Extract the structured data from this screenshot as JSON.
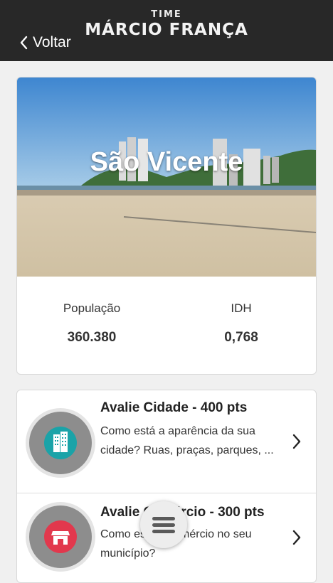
{
  "header": {
    "back_label": "Voltar",
    "brand_top": "TIME",
    "brand_main": "MÁRCIO FRANÇA",
    "background": "#282828"
  },
  "city": {
    "name": "São Vicente",
    "stats": [
      {
        "label": "População",
        "value": "360.380"
      },
      {
        "label": "IDH",
        "value": "0,768"
      }
    ]
  },
  "tasks": [
    {
      "title": "Avalie Cidade - 400 pts",
      "description": "Como está a aparência da sua cidade? Ruas, praças, parques, ...",
      "icon": "buildings-icon",
      "icon_color": "#1aa3a8"
    },
    {
      "title": "Avalie Comércio - 300 pts",
      "description": "Como está o comércio no seu município?",
      "icon": "store-icon",
      "icon_color": "#e2384d"
    }
  ]
}
